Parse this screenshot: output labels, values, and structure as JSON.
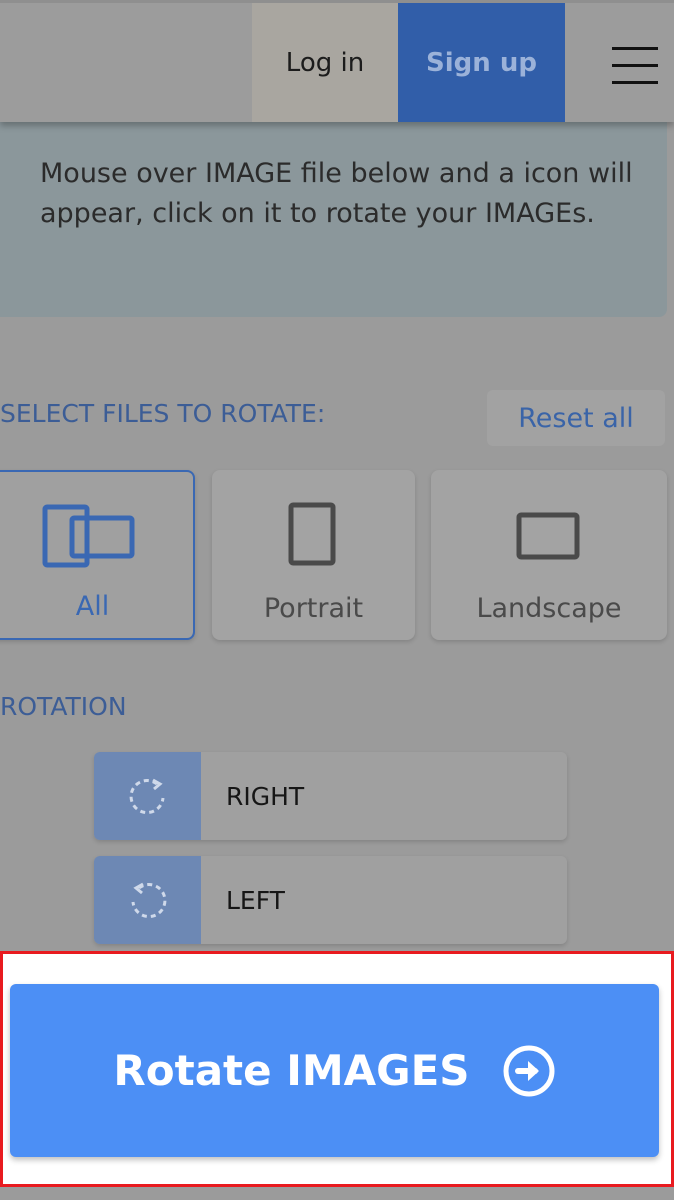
{
  "header": {
    "login_label": "Log in",
    "signup_label": "Sign up",
    "menu_icon": "hamburger-menu-icon"
  },
  "info": {
    "text": "Mouse over IMAGE file below and a icon will appear, click on it to rotate your IMAGEs."
  },
  "select": {
    "title": "SELECT FILES TO ROTATE:",
    "reset_label": "Reset all",
    "filters": [
      {
        "label": "All",
        "icon": "all-orientations-icon",
        "selected": true
      },
      {
        "label": "Portrait",
        "icon": "portrait-icon",
        "selected": false
      },
      {
        "label": "Landscape",
        "icon": "landscape-icon",
        "selected": false
      }
    ]
  },
  "rotation": {
    "title": "ROTATION",
    "options": [
      {
        "label": "RIGHT",
        "icon": "rotate-right-icon"
      },
      {
        "label": "LEFT",
        "icon": "rotate-left-icon"
      }
    ]
  },
  "action": {
    "rotate_label": "Rotate IMAGES",
    "icon": "arrow-right-circle-icon"
  },
  "colors": {
    "accent": "#4c8ff5",
    "signup_bg": "#315ea9",
    "highlight_border": "#e81a1f"
  }
}
